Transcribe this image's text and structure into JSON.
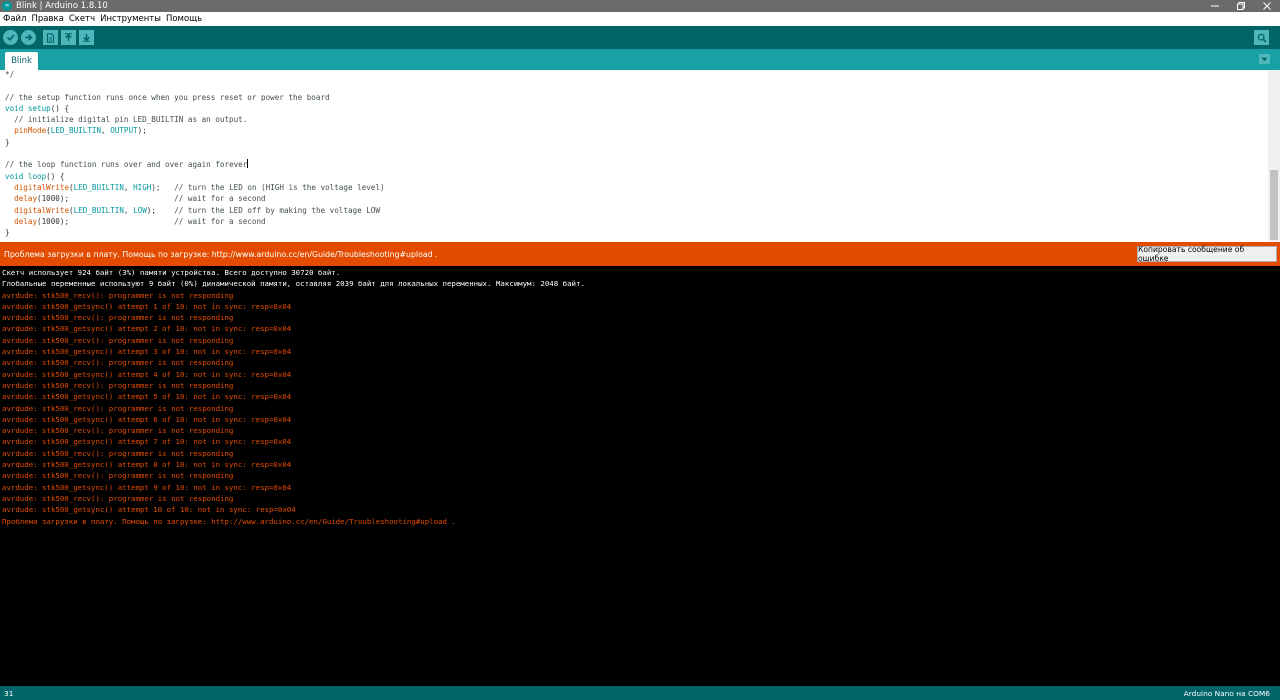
{
  "window": {
    "title": "Blink | Arduino 1.8.10",
    "app_icon": "arduino-logo-icon",
    "controls": [
      "minimize-icon",
      "restore-icon",
      "close-icon"
    ]
  },
  "menu": [
    "Файл",
    "Правка",
    "Скетч",
    "Инструменты",
    "Помощь"
  ],
  "toolbar": {
    "buttons": [
      "verify-icon",
      "upload-arrow-icon",
      "new-file-icon",
      "open-file-icon",
      "save-icon"
    ],
    "right_button": "serial-monitor-icon",
    "accent": "#006468"
  },
  "tabs": [
    {
      "label": "Blink"
    }
  ],
  "editor": {
    "lines": [
      [
        {
          "t": "*/",
          "c": "cmt"
        }
      ],
      [],
      [
        {
          "t": "// the setup function runs once when you press reset or power the board",
          "c": "cmt"
        }
      ],
      [
        {
          "t": "void",
          "c": "kw"
        },
        {
          "t": " "
        },
        {
          "t": "setup",
          "c": "kw"
        },
        {
          "t": "() {"
        }
      ],
      [
        {
          "t": "  // initialize digital pin LED_BUILTIN as an output.",
          "c": "cmt"
        }
      ],
      [
        {
          "t": "  "
        },
        {
          "t": "pinMode",
          "c": "fn"
        },
        {
          "t": "("
        },
        {
          "t": "LED_BUILTIN",
          "c": "cst"
        },
        {
          "t": ", "
        },
        {
          "t": "OUTPUT",
          "c": "cst"
        },
        {
          "t": ");"
        }
      ],
      [
        {
          "t": "}"
        }
      ],
      [],
      [
        {
          "t": "// the loop function runs over and over again forever",
          "c": "cmt"
        },
        {
          "t": "",
          "cursor": true
        }
      ],
      [
        {
          "t": "void",
          "c": "kw"
        },
        {
          "t": " "
        },
        {
          "t": "loop",
          "c": "kw"
        },
        {
          "t": "() {"
        }
      ],
      [
        {
          "t": "  "
        },
        {
          "t": "digitalWrite",
          "c": "fn"
        },
        {
          "t": "("
        },
        {
          "t": "LED_BUILTIN",
          "c": "cst"
        },
        {
          "t": ", "
        },
        {
          "t": "HIGH",
          "c": "cst"
        },
        {
          "t": ");   "
        },
        {
          "t": "// turn the LED on (HIGH is the voltage level)",
          "c": "cmt"
        }
      ],
      [
        {
          "t": "  "
        },
        {
          "t": "delay",
          "c": "fn"
        },
        {
          "t": "(1000);                       "
        },
        {
          "t": "// wait for a second",
          "c": "cmt"
        }
      ],
      [
        {
          "t": "  "
        },
        {
          "t": "digitalWrite",
          "c": "fn"
        },
        {
          "t": "("
        },
        {
          "t": "LED_BUILTIN",
          "c": "cst"
        },
        {
          "t": ", "
        },
        {
          "t": "LOW",
          "c": "cst"
        },
        {
          "t": ");    "
        },
        {
          "t": "// turn the LED off by making the voltage LOW",
          "c": "cmt"
        }
      ],
      [
        {
          "t": "  "
        },
        {
          "t": "delay",
          "c": "fn"
        },
        {
          "t": "(1000);                       "
        },
        {
          "t": "// wait for a second",
          "c": "cmt"
        }
      ],
      [
        {
          "t": "}"
        }
      ]
    ]
  },
  "error_bar": {
    "message": "Проблема загрузки в плату. Помощь по загрузке: http://www.arduino.cc/en/Guide/Troubleshooting#upload .",
    "copy_button": "Копировать сообщение об ошибке",
    "color": "#e34c00"
  },
  "console": {
    "lines": [
      {
        "text": "Скетч использует 924 байт (3%) памяти устройства. Всего доступно 30720 байт.",
        "kind": "w"
      },
      {
        "text": "Глобальные переменные используют 9 байт (0%) динамической памяти, оставляя 2039 байт для локальных переменных. Максимум: 2048 байт.",
        "kind": "w"
      },
      {
        "text": "avrdude: stk500_recv(): programmer is not responding",
        "kind": "e"
      },
      {
        "text": "avrdude: stk500_getsync() attempt 1 of 10: not in sync: resp=0x04",
        "kind": "e"
      },
      {
        "text": "avrdude: stk500_recv(): programmer is not responding",
        "kind": "e"
      },
      {
        "text": "avrdude: stk500_getsync() attempt 2 of 10: not in sync: resp=0x04",
        "kind": "e"
      },
      {
        "text": "avrdude: stk500_recv(): programmer is not responding",
        "kind": "e"
      },
      {
        "text": "avrdude: stk500_getsync() attempt 3 of 10: not in sync: resp=0x04",
        "kind": "e"
      },
      {
        "text": "avrdude: stk500_recv(): programmer is not responding",
        "kind": "e"
      },
      {
        "text": "avrdude: stk500_getsync() attempt 4 of 10: not in sync: resp=0x04",
        "kind": "e"
      },
      {
        "text": "avrdude: stk500_recv(): programmer is not responding",
        "kind": "e"
      },
      {
        "text": "avrdude: stk500_getsync() attempt 5 of 10: not in sync: resp=0x04",
        "kind": "e"
      },
      {
        "text": "avrdude: stk500_recv(): programmer is not responding",
        "kind": "e"
      },
      {
        "text": "avrdude: stk500_getsync() attempt 6 of 10: not in sync: resp=0x04",
        "kind": "e"
      },
      {
        "text": "avrdude: stk500_recv(): programmer is not responding",
        "kind": "e"
      },
      {
        "text": "avrdude: stk500_getsync() attempt 7 of 10: not in sync: resp=0x04",
        "kind": "e"
      },
      {
        "text": "avrdude: stk500_recv(): programmer is not responding",
        "kind": "e"
      },
      {
        "text": "avrdude: stk500_getsync() attempt 8 of 10: not in sync: resp=0x04",
        "kind": "e"
      },
      {
        "text": "avrdude: stk500_recv(): programmer is not responding",
        "kind": "e"
      },
      {
        "text": "avrdude: stk500_getsync() attempt 9 of 10: not in sync: resp=0x04",
        "kind": "e"
      },
      {
        "text": "avrdude: stk500_recv(): programmer is not responding",
        "kind": "e"
      },
      {
        "text": "avrdude: stk500_getsync() attempt 10 of 10: not in sync: resp=0x04",
        "kind": "e"
      },
      {
        "text": "Проблема загрузки в плату. Помощь по загрузке: http://www.arduino.cc/en/Guide/Troubleshooting#upload .",
        "kind": "e"
      }
    ]
  },
  "status": {
    "line_number": "31",
    "board": "Arduino Nano на COM6"
  }
}
